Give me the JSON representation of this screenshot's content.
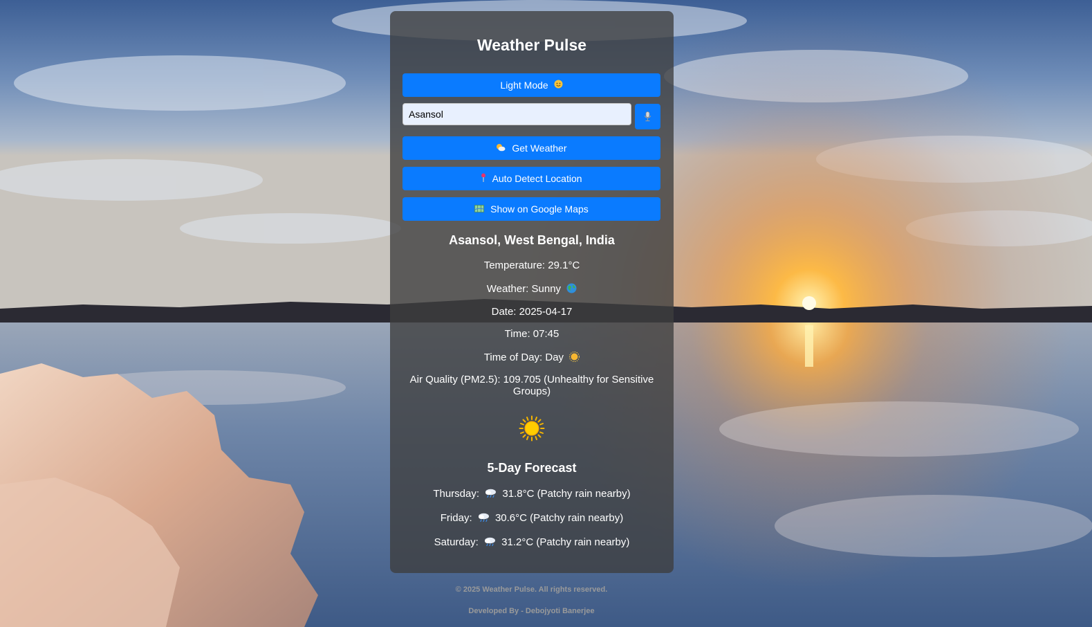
{
  "app": {
    "title": "Weather Pulse"
  },
  "controls": {
    "theme_toggle_label": "Light Mode",
    "city_input_value": "Asansol",
    "get_weather_label": "Get Weather",
    "auto_detect_label": "Auto Detect Location",
    "google_maps_label": "Show on Google Maps"
  },
  "weather": {
    "location": "Asansol, West Bengal, India",
    "temperature": "Temperature: 29.1°C",
    "condition": "Weather: Sunny",
    "date": "Date: 2025-04-17",
    "time": "Time: 07:45",
    "time_of_day": "Time of Day: Day",
    "air_quality": "Air Quality (PM2.5): 109.705 (Unhealthy for Sensitive Groups)",
    "main_icon": "sun-icon"
  },
  "forecast": {
    "title": "5-Day Forecast",
    "days": [
      {
        "day": "Thursday:",
        "detail": "31.8°C (Patchy rain nearby)",
        "icon": "rain-cloud-icon"
      },
      {
        "day": "Friday:",
        "detail": "30.6°C (Patchy rain nearby)",
        "icon": "rain-cloud-icon"
      },
      {
        "day": "Saturday:",
        "detail": "31.2°C (Patchy rain nearby)",
        "icon": "rain-cloud-icon"
      }
    ]
  },
  "footer": {
    "copyright": "© 2025 Weather Pulse. All rights reserved.",
    "developer": "Developed By - Debojyoti Banerjee"
  },
  "colors": {
    "button": "#0a7bff",
    "card": "rgba(62,62,62,0.78)",
    "text": "#ffffff",
    "footer_text": "#9a9a9a"
  }
}
